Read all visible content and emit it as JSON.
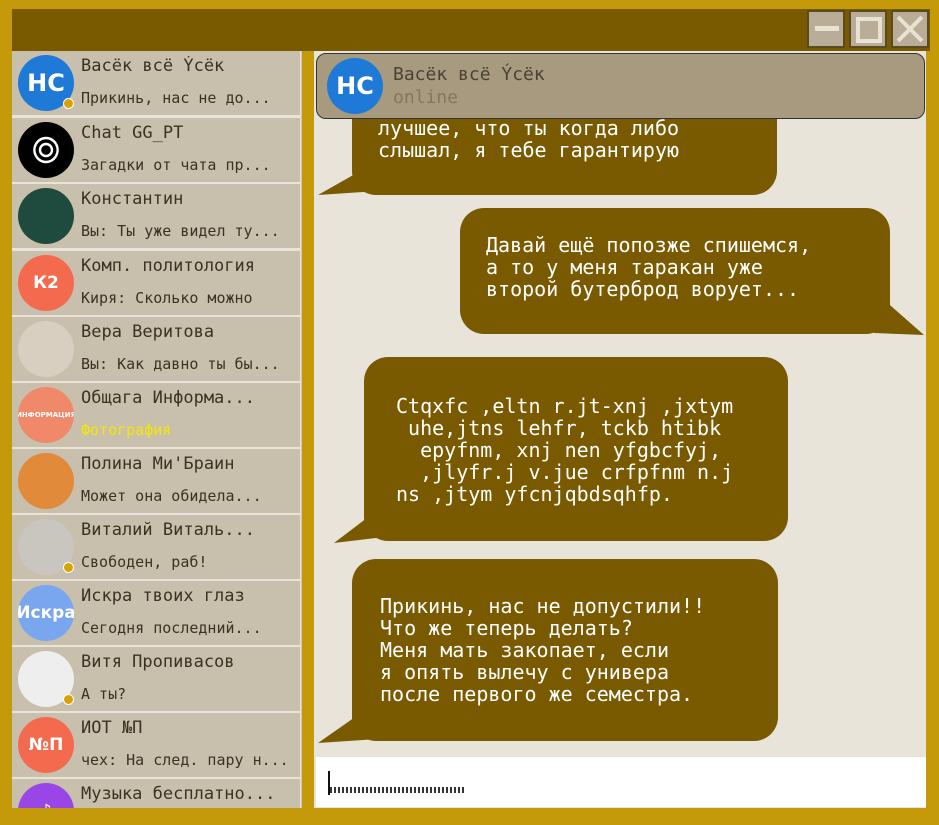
{
  "window": {
    "controls": [
      {
        "name": "minimize-icon"
      },
      {
        "name": "maximize-icon"
      },
      {
        "name": "close-icon"
      }
    ]
  },
  "sidebar": {
    "items": [
      {
        "name": "Васёк всё Ýсёк",
        "preview": "Прикинь, нас не до...",
        "avatar_text": "НС",
        "avatar_color": "#1e7ad6",
        "dot": true,
        "accent": false
      },
      {
        "name": "Chat GG_PT",
        "preview": "Загадки от чата пр...",
        "avatar_text": "",
        "avatar_color": "#000000",
        "dot": false,
        "accent": false
      },
      {
        "name": "Константин",
        "preview": "Вы: Ты уже видел ту...",
        "avatar_text": "",
        "avatar_color": "#1f4b3e",
        "dot": false,
        "accent": false
      },
      {
        "name": "Комп. политология",
        "preview": "Киря: Сколько можно",
        "avatar_text": "К2",
        "avatar_color": "#f46a4e",
        "dot": false,
        "accent": false
      },
      {
        "name": "Вера Веритова",
        "preview": "Вы: Как давно ты бы...",
        "avatar_text": "",
        "avatar_color": "#d9cfc0",
        "dot": false,
        "accent": false
      },
      {
        "name": "Общага Информа...",
        "preview": "Фотография",
        "avatar_text": "ИНФОРМАЦИЯ",
        "avatar_color": "#f0886a",
        "dot": false,
        "accent": true
      },
      {
        "name": "Полина Ми'Браин",
        "preview": "Может она обидела...",
        "avatar_text": "",
        "avatar_color": "#e08a3a",
        "dot": false,
        "accent": false
      },
      {
        "name": "Виталий Виталь...",
        "preview": "Свободен, раб!",
        "avatar_text": "",
        "avatar_color": "#c9c6c0",
        "dot": true,
        "accent": false
      },
      {
        "name": "Искра твоих глаз",
        "preview": "Сегодня последний...",
        "avatar_text": "Искра",
        "avatar_color": "#7aa6ef",
        "dot": false,
        "accent": false
      },
      {
        "name": "Витя Пропивасов",
        "preview": "А ты?",
        "avatar_text": "",
        "avatar_color": "#eeeeee",
        "dot": true,
        "accent": false
      },
      {
        "name": "ИОТ №П",
        "preview": "чех: На след. пару н...",
        "avatar_text": "№П",
        "avatar_color": "#f46a4e",
        "dot": false,
        "accent": false
      },
      {
        "name": "Музыка бесплатно...",
        "preview": "",
        "avatar_text": "♪",
        "avatar_color": "#9a46e6",
        "dot": false,
        "accent": false
      }
    ]
  },
  "header": {
    "name": "Васёк всё Ýсёк",
    "status": "online",
    "avatar_text": "НС"
  },
  "messages": [
    {
      "side": "in",
      "text": "лучшее, что ты когда либо\nслышал, я тебе гарантирую"
    },
    {
      "side": "out",
      "text": "Давай ещё попозже спишемся,\nа то у меня таракан уже\nвторой бутерброд ворует..."
    },
    {
      "side": "in",
      "text": "Ctqxfc ,eltn r.jt-xnj ,jxtym\n uhe,jtns lehfr, tckb htibk\n  epyfnm, xnj nen yfgbcfyj,\n  ,jlyfr.j v.jue crfpfnm n.j\nns ,jtym yfcnjqbdsqhfp."
    },
    {
      "side": "in",
      "text": "Прикинь, нас не допустили!!\nЧто же теперь делать?\nМеня мать закопает, если\nя опять вылечу с универа\nпосле первого же семестра."
    }
  ],
  "composer": {
    "value": "",
    "placeholder": ""
  },
  "colors": {
    "frame": "#c49a0b",
    "bubble": "#7a5a00",
    "list_item": "#c8bfad",
    "panel": "#e8e4da",
    "accent_text": "#f5e800"
  }
}
